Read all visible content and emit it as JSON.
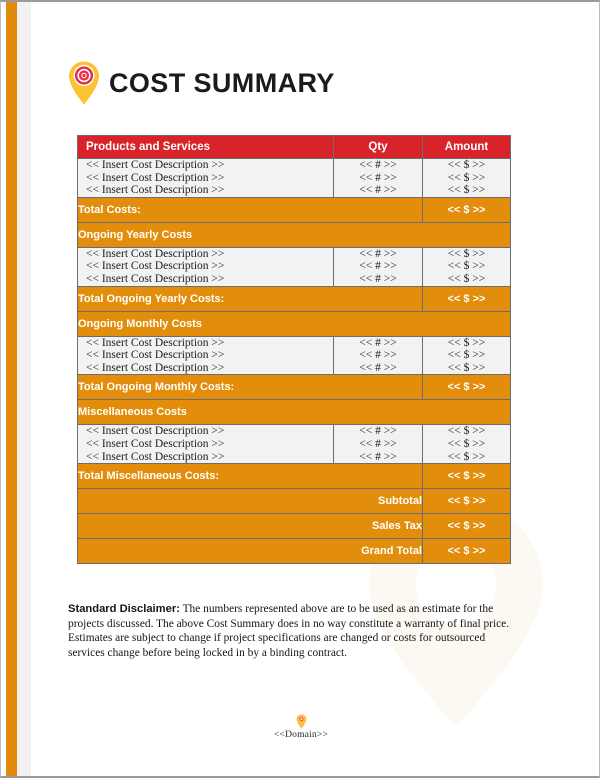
{
  "document": {
    "title": "COST SUMMARY",
    "logo_icon": "map-pin-target-icon"
  },
  "table": {
    "columns": {
      "description": "Products and Services",
      "qty": "Qty",
      "amount": "Amount"
    },
    "placeholders": {
      "description": "<< Insert Cost Description >>",
      "qty": "<< # >>",
      "amount": "<< $ >>"
    },
    "sections": [
      {
        "items": [
          {
            "description": "<< Insert Cost Description >>",
            "qty": "<< # >>",
            "amount": "<< $ >>"
          },
          {
            "description": "<< Insert Cost Description >>",
            "qty": "<< # >>",
            "amount": "<< $ >>"
          },
          {
            "description": "<< Insert Cost Description >>",
            "qty": "<< # >>",
            "amount": "<< $ >>"
          }
        ],
        "total_label": "Total Costs:",
        "total_amount": "<< $ >>"
      },
      {
        "heading": "Ongoing Yearly Costs",
        "items": [
          {
            "description": "<< Insert Cost Description >>",
            "qty": "<< # >>",
            "amount": "<< $ >>"
          },
          {
            "description": "<< Insert Cost Description >>",
            "qty": "<< # >>",
            "amount": "<< $ >>"
          },
          {
            "description": "<< Insert Cost Description >>",
            "qty": "<< # >>",
            "amount": "<< $ >>"
          }
        ],
        "total_label": "Total Ongoing Yearly Costs:",
        "total_amount": "<< $ >>"
      },
      {
        "heading": "Ongoing Monthly Costs",
        "items": [
          {
            "description": "<< Insert Cost Description >>",
            "qty": "<< # >>",
            "amount": "<< $ >>"
          },
          {
            "description": "<< Insert Cost Description >>",
            "qty": "<< # >>",
            "amount": "<< $ >>"
          },
          {
            "description": "<< Insert Cost Description >>",
            "qty": "<< # >>",
            "amount": "<< $ >>"
          }
        ],
        "total_label": "Total Ongoing Monthly Costs:",
        "total_amount": "<< $ >>"
      },
      {
        "heading": "Miscellaneous Costs",
        "items": [
          {
            "description": "<< Insert Cost Description >>",
            "qty": "<< # >>",
            "amount": "<< $ >>"
          },
          {
            "description": "<< Insert Cost Description >>",
            "qty": "<< # >>",
            "amount": "<< $ >>"
          },
          {
            "description": "<< Insert Cost Description >>",
            "qty": "<< # >>",
            "amount": "<< $ >>"
          }
        ],
        "total_label": "Total Miscellaneous Costs:",
        "total_amount": "<< $ >>"
      }
    ],
    "summary": [
      {
        "label": "Subtotal",
        "amount": "<< $ >>"
      },
      {
        "label": "Sales Tax",
        "amount": "<< $ >>"
      },
      {
        "label": "Grand Total",
        "amount": "<< $ >>"
      }
    ]
  },
  "disclaimer": {
    "lead": "Standard Disclaimer:",
    "body": " The numbers represented above are to be used as an estimate for the projects discussed. The above Cost Summary does in no way constitute a warranty of final price.  Estimates are subject to change if project specifications are changed or costs for outsourced services change before being locked in by a binding contract."
  },
  "footer": {
    "domain": "<<Domain>>",
    "pin_icon": "map-pin-icon"
  },
  "colors": {
    "header_red": "#D8232A",
    "total_orange": "#E28E0C",
    "row_gray": "#f2f2f2",
    "edge_orange": "#E28A0C",
    "pin_yellow": "#FBC233",
    "pin_target_red": "#E53143"
  }
}
